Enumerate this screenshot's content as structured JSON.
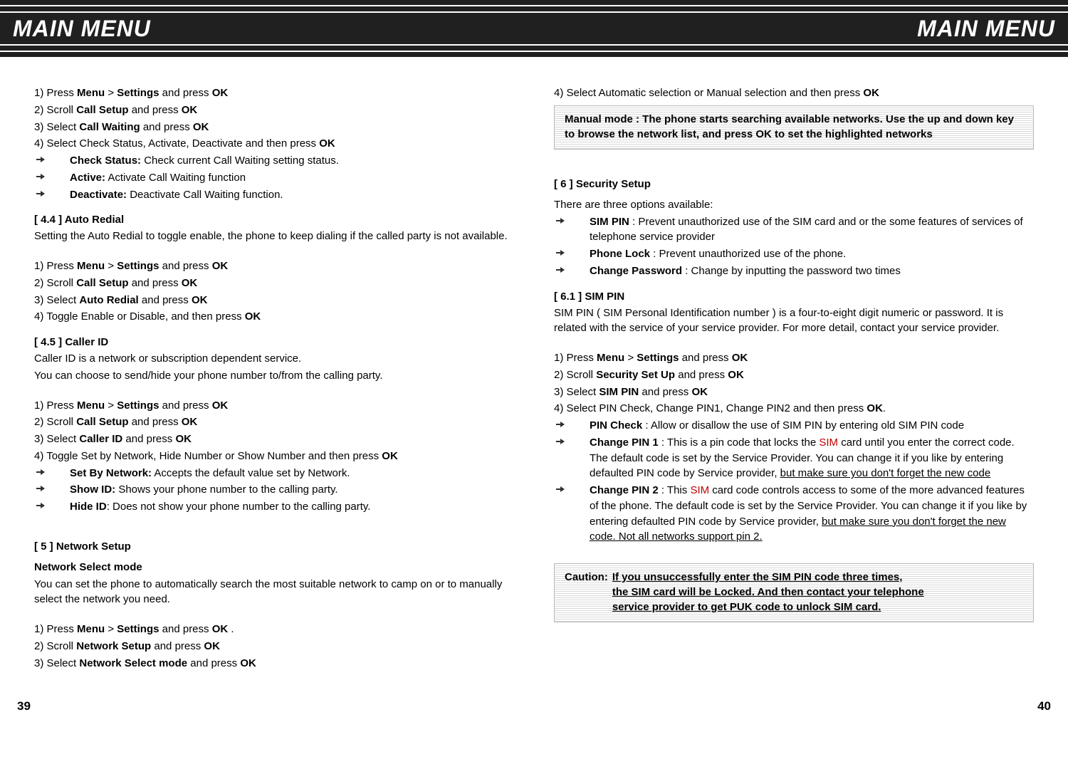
{
  "header": {
    "title_left": "MAIN MENU",
    "title_right": "MAIN MENU"
  },
  "left": {
    "steps_cw": [
      {
        "n": "1)",
        "pre": "Press ",
        "b1": "Menu",
        "mid": " > ",
        "b2": "Settings",
        "post": " and press ",
        "b3": "OK"
      },
      {
        "n": "2)",
        "pre": "Scroll ",
        "b1": "Call Setup",
        "post": " and press ",
        "b3": "OK"
      },
      {
        "n": "3)",
        "pre": "Select ",
        "b1": "Call Waiting",
        "post": " and press ",
        "b3": "OK"
      },
      {
        "n": "4)",
        "pre": "Select Check Status, Activate, Deactivate and then press ",
        "b3": "OK"
      }
    ],
    "cw_bullets": [
      {
        "b": "Check Status:",
        "t": " Check current Call Waiting setting status."
      },
      {
        "b": "Active:",
        "t": " Activate Call Waiting function"
      },
      {
        "b": "Deactivate:",
        "t": " Deactivate Call Waiting function."
      }
    ],
    "s44_head": "[ 4.4 ]  Auto Redial",
    "s44_body": "Setting the Auto Redial to toggle enable, the phone to keep dialing if the called party is not available.",
    "steps_ar": [
      {
        "n": "1)",
        "pre": "Press ",
        "b1": "Menu",
        "mid": " > ",
        "b2": "Settings",
        "post": " and press ",
        "b3": "OK"
      },
      {
        "n": "2)",
        "pre": "Scroll ",
        "b1": "Call Setup",
        "post": " and press ",
        "b3": "OK"
      },
      {
        "n": "3)",
        "pre": "Select ",
        "b1": "Auto Redial",
        "post": " and press ",
        "b3": "OK"
      },
      {
        "n": "4)",
        "pre": "Toggle Enable or Disable, and then press ",
        "b3": "OK"
      }
    ],
    "s45_head": "[ 4.5 ]  Caller ID",
    "s45_b1": "Caller ID is a network or subscription dependent service.",
    "s45_b2": "You can choose to send/hide your phone number to/from the calling party.",
    "steps_cid": [
      {
        "n": "1)",
        "pre": "Press ",
        "b1": "Menu",
        "mid": " > ",
        "b2": "Settings",
        "post": " and press ",
        "b3": "OK"
      },
      {
        "n": "2)",
        "pre": "Scroll ",
        "b1": "Call Setup",
        "post": " and press ",
        "b3": "OK"
      },
      {
        "n": "3)",
        "pre": "Select ",
        "b1": "Caller ID",
        "post": " and press ",
        "b3": "OK"
      },
      {
        "n": "4)",
        "pre": "Toggle Set by Network, Hide Number or Show Number and then press ",
        "b3": "OK"
      }
    ],
    "cid_bullets": [
      {
        "b": "Set By Network:",
        "t": " Accepts the default value set by Network."
      },
      {
        "b": "Show ID:",
        "t": " Shows your phone number to the calling party."
      },
      {
        "b": "Hide ID",
        "t": ": Does not show your phone number to the calling party."
      }
    ],
    "s5_head": "[ 5 ]  Network Setup",
    "s5_sub": " Network Select mode",
    "s5_body": "You can set the phone to automatically search the most suitable network to camp on or to manually select the network you need.",
    "steps_ns": [
      {
        "n": "1)",
        "pre": "Press ",
        "b1": "Menu",
        "mid": " > ",
        "b2": "Settings",
        "post": " and press ",
        "b3": "OK",
        "tail": " ."
      },
      {
        "n": "2)",
        "pre": "Scroll ",
        "b1": "Network Setup",
        "post": " and press ",
        "b3": "OK"
      },
      {
        "n": "3)",
        "pre": "Select ",
        "b1": "Network Select mode",
        "post": " and press ",
        "b3": "OK"
      }
    ]
  },
  "right": {
    "step4": {
      "n": "4)",
      "pre": "Select Automatic selection or Manual selection and then press ",
      "b3": "OK"
    },
    "manual_note": "Manual mode : The phone starts searching available networks. Use the up and down key to browse the network list, and press OK to set the highlighted networks",
    "s6_head": "[ 6 ]  Security Setup",
    "s6_intro": "There are three options available:",
    "s6_bullets": [
      {
        "b": "SIM PIN",
        "t": " : Prevent unauthorized use of the SIM card and or the some features of services of telephone service provider"
      },
      {
        "b": "Phone Lock",
        "t": " : Prevent unauthorized use of the phone."
      },
      {
        "b": "Change Password",
        "t": " : Change by inputting the password  two times"
      }
    ],
    "s61_head": "[ 6.1 ]  SIM PIN",
    "s61_body": "SIM PIN ( SIM Personal Identification number ) is a four-to-eight digit numeric or password. It is related with the service of your service provider. For more detail, contact your service provider.",
    "steps_sp": [
      {
        "n": "1)",
        "pre": "Press ",
        "b1": "Menu",
        "mid": " > ",
        "b2": "Settings",
        "post": " and press ",
        "b3": "OK"
      },
      {
        "n": "2)",
        "pre": "Scroll ",
        "b1": "Security Set Up",
        "post": " and press ",
        "b3": "OK"
      },
      {
        "n": "3)",
        "pre": "Select ",
        "b1": "SIM PIN",
        "post": " and press ",
        "b3": "OK"
      },
      {
        "n": "4)",
        "pre": "Select PIN Check, Change PIN1, Change PIN2 and then press ",
        "b3": "OK",
        "tail": "."
      }
    ],
    "pin_bullets": [
      {
        "b": "PIN Check",
        "t_parts": [
          {
            "t": " : Allow or disallow the use of SIM PIN by entering old SIM PIN code"
          }
        ]
      },
      {
        "b": "Change PIN 1",
        "t_parts": [
          {
            "t": " : This is a pin code that locks the "
          },
          {
            "t": "SIM",
            "cls": "red"
          },
          {
            "t": " card until you enter the correct code. The default code is set by the Service Provider. You can change it if you like by entering defaulted PIN code by Service provider, "
          },
          {
            "t": "but make sure you don't forget the new code",
            "cls": "u"
          }
        ]
      },
      {
        "b": "Change PIN 2",
        "t_parts": [
          {
            "t": " : This "
          },
          {
            "t": "SIM",
            "cls": "red"
          },
          {
            "t": " card code controls access to some of the more advanced features of the phone. The default code is set by the Service Provider. You can change it if you like by entering defaulted PIN code by Service provider, "
          },
          {
            "t": "but make sure you don't forget the new code. Not all networks support pin 2.",
            "cls": "u"
          }
        ]
      }
    ],
    "caution_label": "Caution:",
    "caution_lines": [
      "If you unsuccessfully enter the SIM PIN code three times,",
      "the SIM card will be Locked. And then contact your telephone",
      "service provider to get PUK code to unlock SIM card."
    ]
  },
  "footer": {
    "left": "39",
    "right": "40"
  }
}
